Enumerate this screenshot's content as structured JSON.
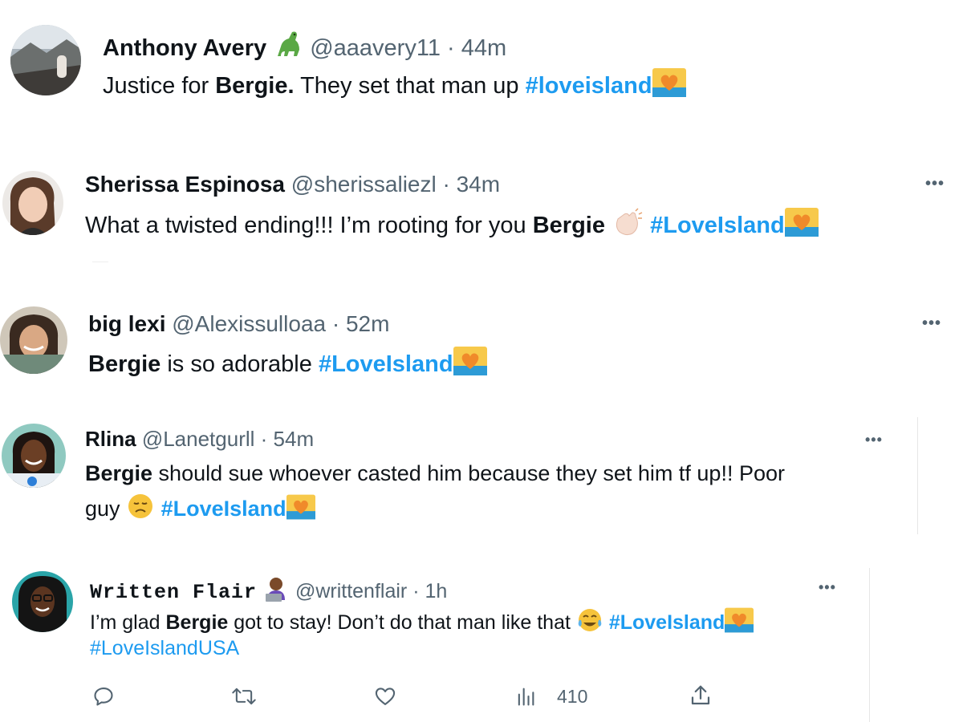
{
  "tweets": [
    {
      "name": "Anthony Avery",
      "name_emoji": "dinosaur-emoji",
      "handle": "@aaavery11",
      "sep": "·",
      "time": "44m",
      "text": [
        "Justice for ",
        "Bergie.",
        " They set that man up "
      ],
      "hashtags": [
        "#loveisland"
      ]
    },
    {
      "name": "Sherissa Espinosa",
      "handle": "@sherissaliezl",
      "sep": "·",
      "time": "34m",
      "text": [
        "What a twisted ending!!! I’m rooting for you ",
        "Bergie",
        " "
      ],
      "hashtags": [
        "#LoveIsland"
      ],
      "more": "•••"
    },
    {
      "name": "big lexi",
      "handle": "@Alexissulloaa",
      "sep": "·",
      "time": "52m",
      "text": [
        "Bergie",
        " is so adorable "
      ],
      "hashtags": [
        "#LoveIsland"
      ],
      "more": "•••"
    },
    {
      "name": "Rlina",
      "handle": "@Lanetgurll",
      "sep": "·",
      "time": "54m",
      "text": [
        "Bergie",
        " should sue whoever casted him because they set him tf up!! Poor",
        "guy "
      ],
      "hashtags": [
        "#LoveIsland"
      ],
      "more": "•••"
    },
    {
      "name": "Written Flair",
      "handle": "@writtenflair",
      "sep": "·",
      "time": "1h",
      "text": [
        "I’m glad ",
        "Bergie",
        " got to stay! Don’t do that man like that "
      ],
      "hashtags": [
        "#LoveIsland",
        "#LoveIslandUSA"
      ],
      "more": "•••",
      "views": "410"
    }
  ],
  "colors": {
    "accent": "#1d9bf0",
    "text": "#0f1419",
    "muted": "#536471"
  },
  "icons": [
    "reply-icon",
    "retweet-icon",
    "like-icon",
    "views-icon",
    "share-icon"
  ]
}
